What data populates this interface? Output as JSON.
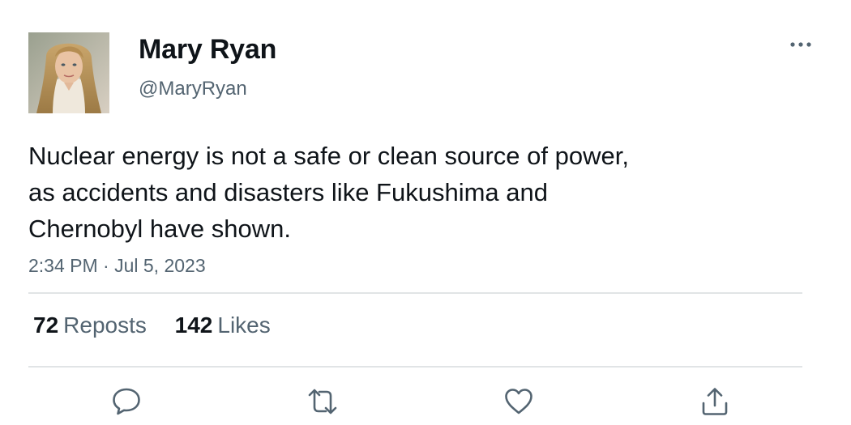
{
  "author": {
    "display_name": "Mary Ryan",
    "handle": "@MaryRyan",
    "avatar": "profile-photo"
  },
  "tweet": {
    "text_lines": [
      "Nuclear energy is not a safe or clean source of power,",
      "as accidents and disasters like Fukushima and",
      "Chernobyl have shown."
    ],
    "timestamp": "2:34 PM · Jul 5, 2023"
  },
  "stats": {
    "reposts_count": "72",
    "reposts_label": "Reposts",
    "likes_count": "142",
    "likes_label": "Likes"
  },
  "actions": [
    {
      "name": "reply",
      "icon": "speech-bubble-icon"
    },
    {
      "name": "repost",
      "icon": "repost-arrows-icon"
    },
    {
      "name": "like",
      "icon": "heart-icon"
    },
    {
      "name": "share",
      "icon": "upload-share-icon"
    }
  ],
  "menu": {
    "icon": "more-horizontal-icon"
  },
  "colors": {
    "primary_text": "#0f1419",
    "secondary_text": "#536471",
    "divider": "#e1e4e6",
    "icon": "#536471"
  }
}
